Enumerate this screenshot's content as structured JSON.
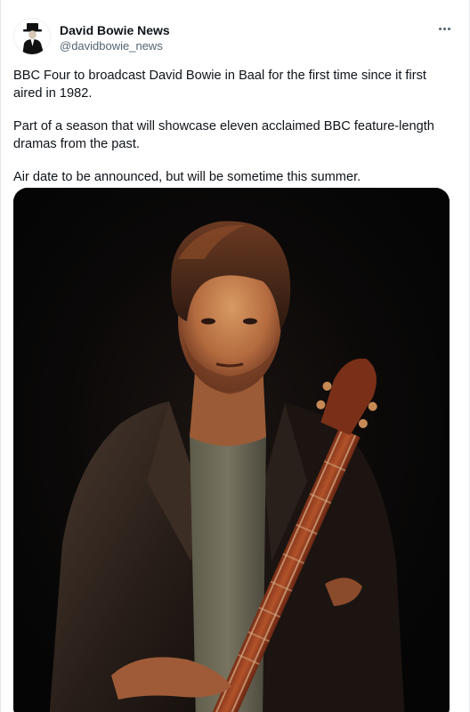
{
  "tweet": {
    "author": {
      "display_name": "David Bowie News",
      "handle": "@davidbowie_news",
      "avatar_icon": "man-in-hat-avatar-icon"
    },
    "more_icon": "more-options-icon",
    "paragraphs": [
      "BBC Four to broadcast David Bowie in Baal for the first time since it first aired in 1982.",
      "Part of a season that will showcase eleven acclaimed BBC feature-length dramas from the past.",
      "Air date to be announced, but will be sometime this summer."
    ],
    "media": {
      "description_icon": "photo-man-with-guitar",
      "background_color": "#060608",
      "jacket_color": "#2a201c",
      "shirt_color": "#6d6a57",
      "guitar_color": "#7a3a1e"
    }
  }
}
